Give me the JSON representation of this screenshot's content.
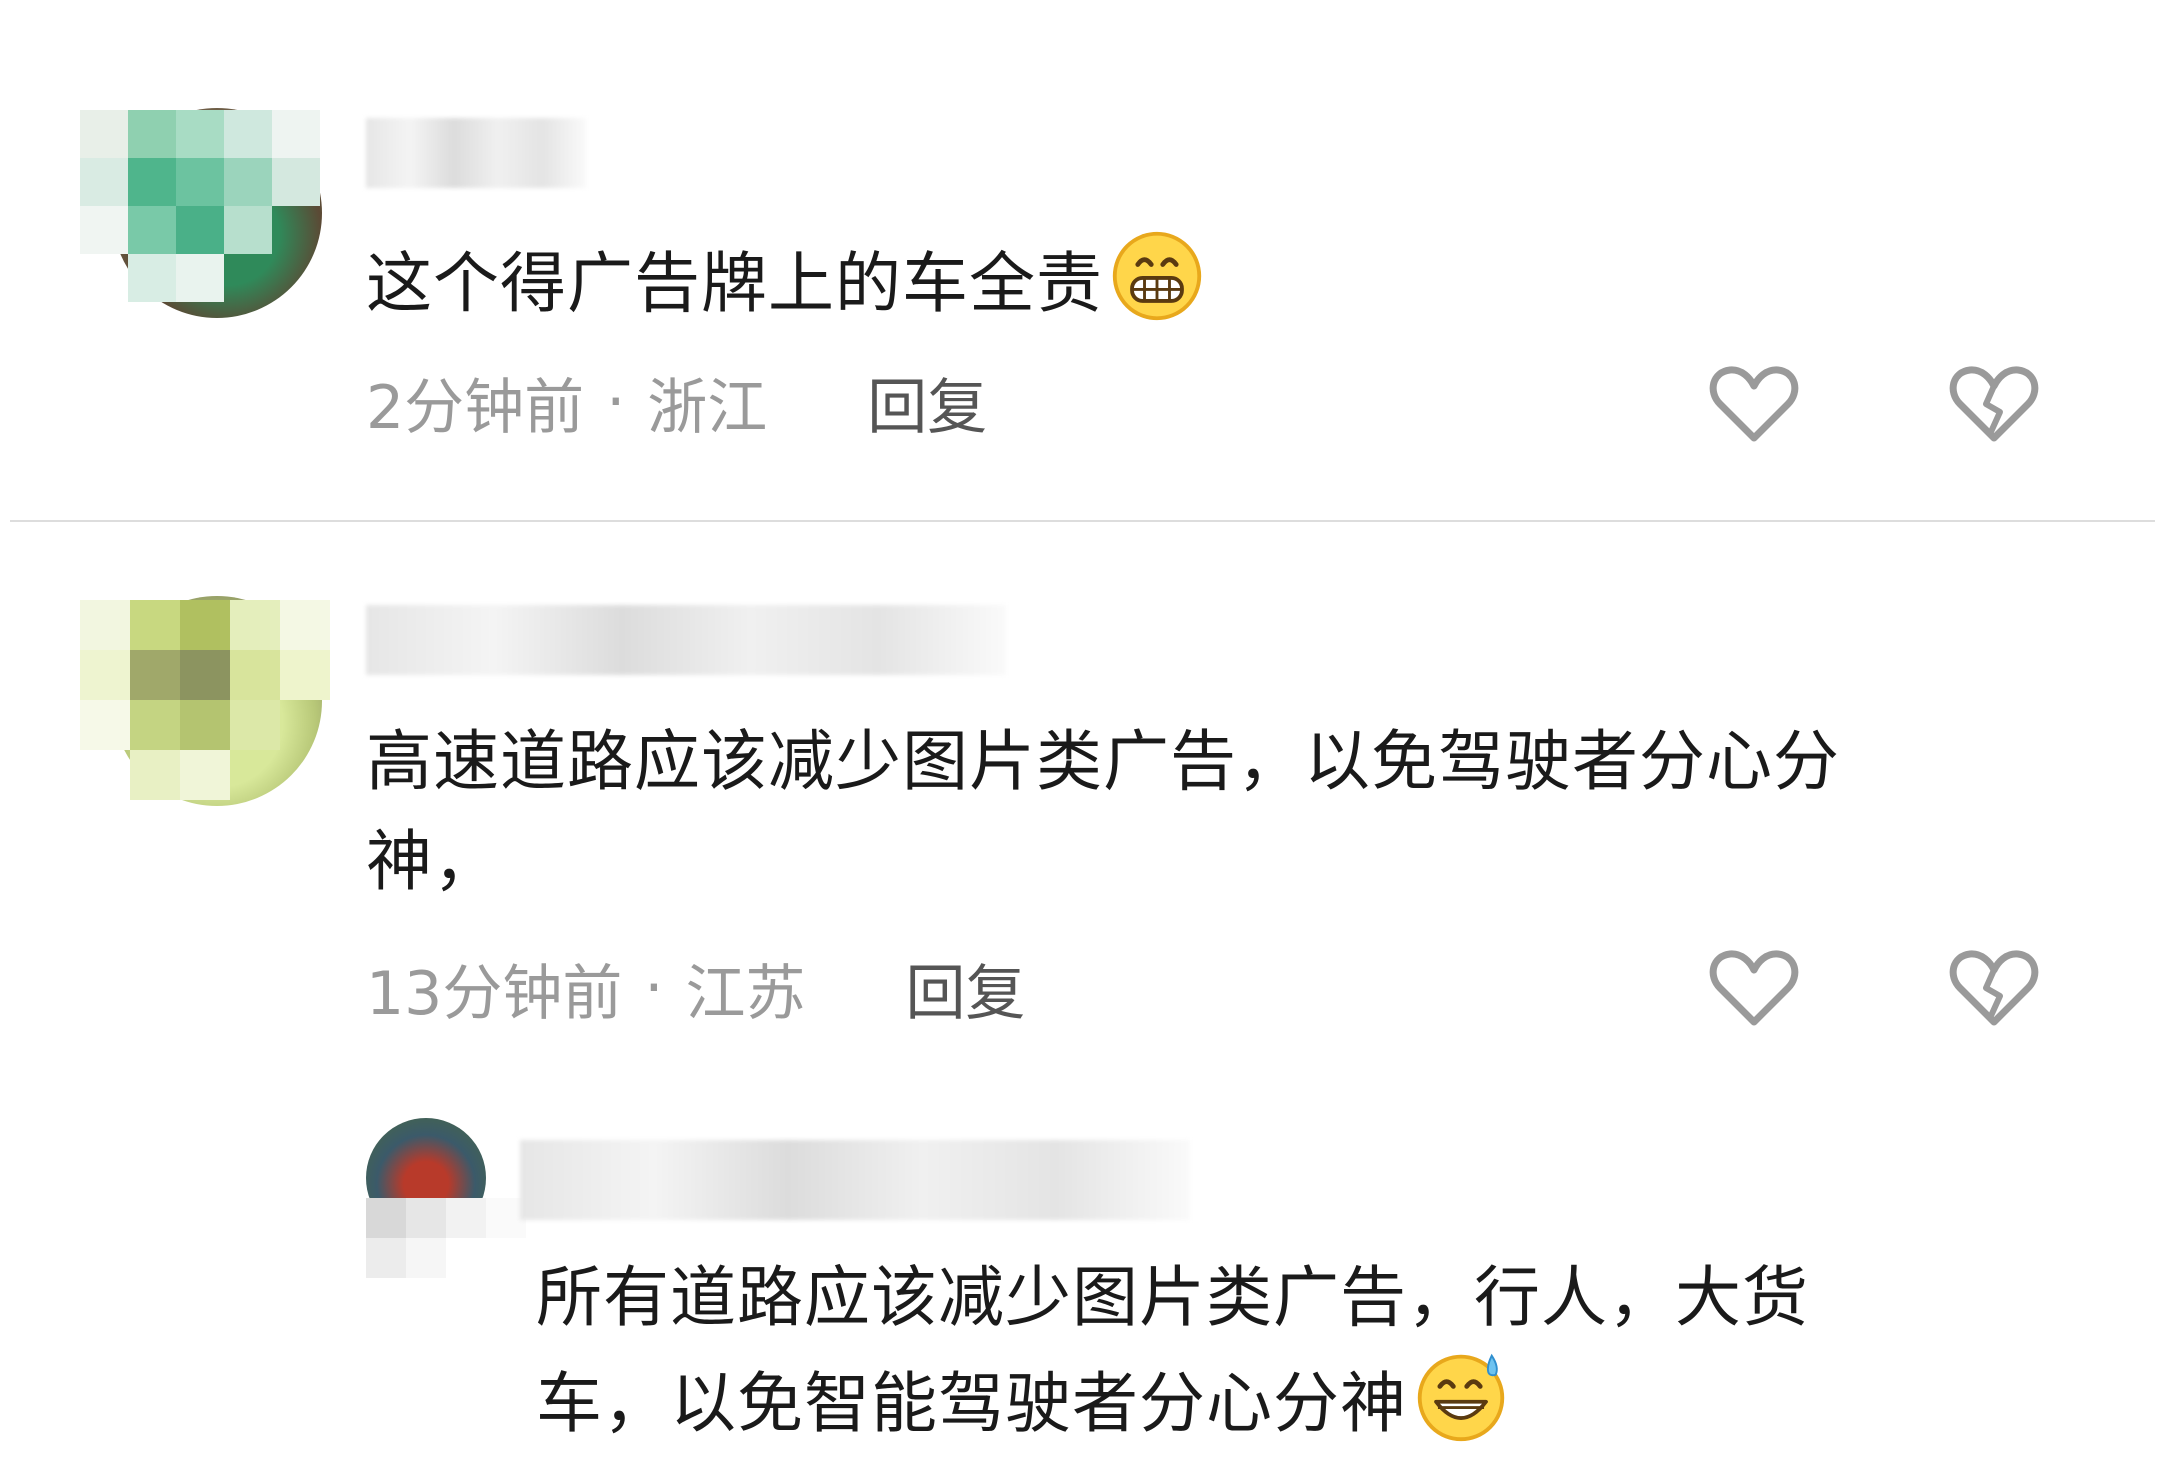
{
  "comments": [
    {
      "text": "这个得广告牌上的车全责",
      "emoji": "grinning-face-emoji",
      "time": "2分钟前",
      "location": "浙江",
      "reply_label": "回复"
    },
    {
      "text_line1": "高速道路应该减少图片类广告，以免驾驶者分心分",
      "text_line2": "神，",
      "time": "13分钟前",
      "location": "江苏",
      "reply_label": "回复"
    }
  ],
  "reply": {
    "text_line1": "所有道路应该减少图片类广告，行人，大货",
    "text_line2": "车，以免智能驾驶者分心分神",
    "emoji": "grinning-sweat-emoji"
  },
  "separator": "·",
  "icons": {
    "like": "heart-icon",
    "dislike": "broken-heart-icon"
  }
}
